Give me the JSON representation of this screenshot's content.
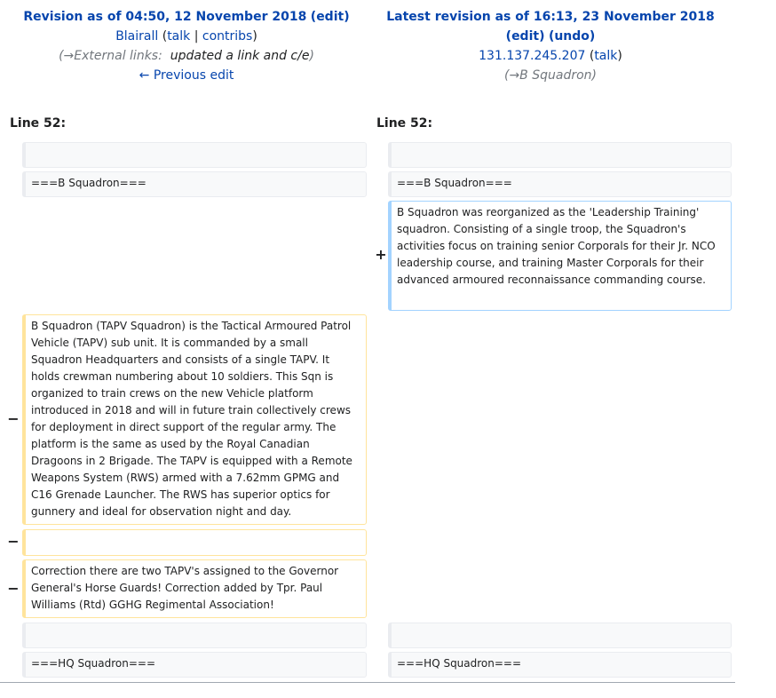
{
  "left_header": {
    "title_prefix": "Revision as of 04:50, 12 November 2018",
    "edit_label": "edit",
    "user": "Blairall",
    "talk": "talk",
    "sep": "|",
    "contribs": "contribs",
    "summary_arrow": "→External links:",
    "summary_comment": "updated a link and c/e",
    "prev_edit": "← Previous edit"
  },
  "right_header": {
    "title": "Latest revision as of 16:13, 23 November 2018",
    "edit_label": "edit",
    "undo_label": "undo",
    "ip": "131.137.245.207",
    "talk": "talk",
    "summary_arrow": "→B Squadron"
  },
  "line_numbers": {
    "left": "Line 52:",
    "right": "Line 52:"
  },
  "left_cells": [
    {
      "type": "context",
      "text": ""
    },
    {
      "type": "context",
      "text": "===B Squadron==="
    },
    {
      "type": "deleted",
      "text": "B Squadron (TAPV Squadron) is the Tactical Armoured Patrol Vehicle (TAPV) sub unit.  It is commanded by a small Squadron Headquarters and consists of a single TAPV. It holds crewman numbering about 10 soldiers. This Sqn is organized to train crews on the new Vehicle platform introduced in 2018 and will in future train collectively crews for deployment in direct support of the regular army. The platform is the same as used by the Royal Canadian Dragoons in 2 Brigade.  The TAPV is equipped with a Remote Weapons System (RWS) armed with a 7.62mm GPMG and C16 Grenade Launcher.  The RWS has superior optics for gunnery and ideal for observation night and day."
    },
    {
      "type": "deleted",
      "text": ""
    },
    {
      "type": "deleted",
      "text": "Correction there are two TAPV's assigned to the Governor General's Horse Guards! Correction added by Tpr. Paul Williams (Rtd) GGHG Regimental Association!"
    },
    {
      "type": "context",
      "text": ""
    },
    {
      "type": "context",
      "text": "===HQ Squadron==="
    }
  ],
  "right_cells": [
    {
      "type": "context",
      "text": ""
    },
    {
      "type": "context",
      "text": "===B Squadron==="
    },
    {
      "type": "added",
      "text": "B Squadron was reorganized as the 'Leadership Training' squadron. Consisting of a single troop, the Squadron's activities focus on training senior Corporals for their Jr. NCO leadership course, and training Master Corporals for their advanced armoured reconnaissance commanding course."
    },
    {
      "type": "context",
      "text": ""
    },
    {
      "type": "context",
      "text": "===HQ Squadron==="
    }
  ],
  "markers": {
    "plus": "+",
    "minus": "−"
  }
}
